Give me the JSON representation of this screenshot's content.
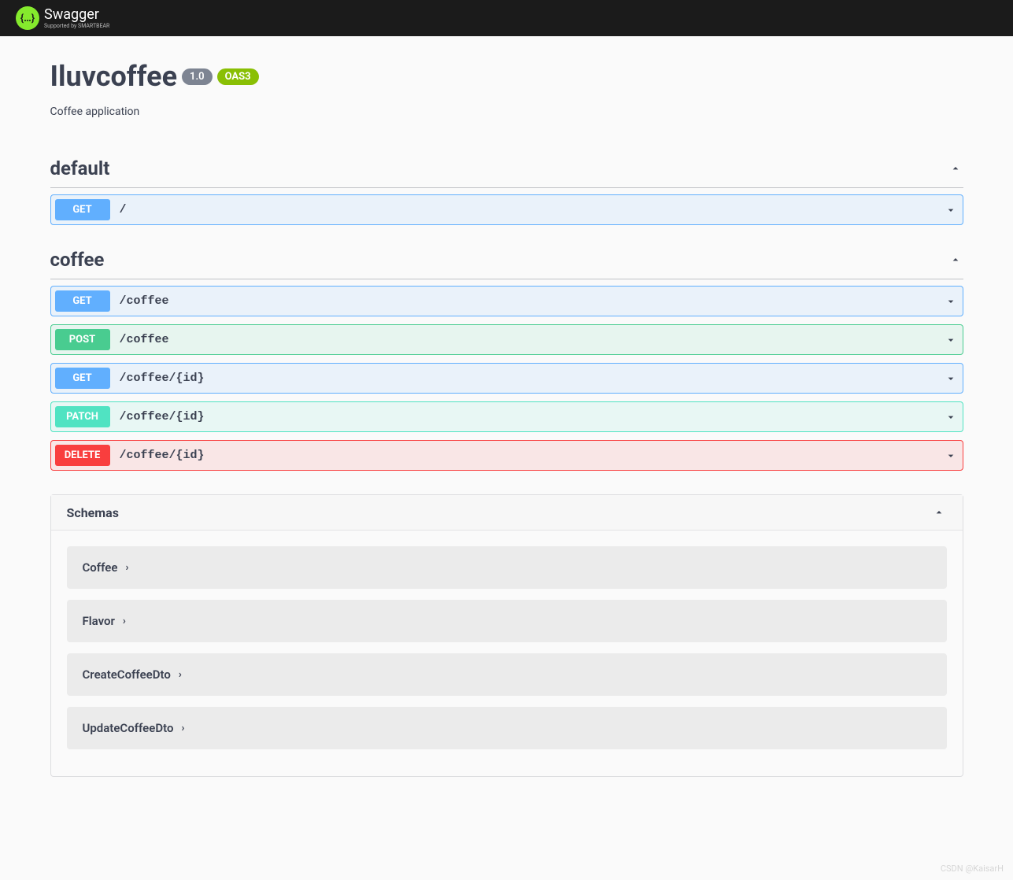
{
  "topbar": {
    "brand": "Swagger",
    "subtext": "Supported by SMARTBEAR",
    "icon_glyph": "{…}"
  },
  "info": {
    "title": "Iluvcoffee",
    "version": "1.0",
    "oas_label": "OAS3",
    "description": "Coffee application"
  },
  "tags": [
    {
      "name": "default",
      "operations": [
        {
          "method": "GET",
          "method_class": "get",
          "path": "/"
        }
      ]
    },
    {
      "name": "coffee",
      "operations": [
        {
          "method": "GET",
          "method_class": "get",
          "path": "/coffee"
        },
        {
          "method": "POST",
          "method_class": "post",
          "path": "/coffee"
        },
        {
          "method": "GET",
          "method_class": "get",
          "path": "/coffee/{id}"
        },
        {
          "method": "PATCH",
          "method_class": "patch",
          "path": "/coffee/{id}"
        },
        {
          "method": "DELETE",
          "method_class": "delete",
          "path": "/coffee/{id}"
        }
      ]
    }
  ],
  "schemas": {
    "title": "Schemas",
    "items": [
      {
        "name": "Coffee"
      },
      {
        "name": "Flavor"
      },
      {
        "name": "CreateCoffeeDto"
      },
      {
        "name": "UpdateCoffeeDto"
      }
    ]
  },
  "watermark": "CSDN @KaisarH"
}
